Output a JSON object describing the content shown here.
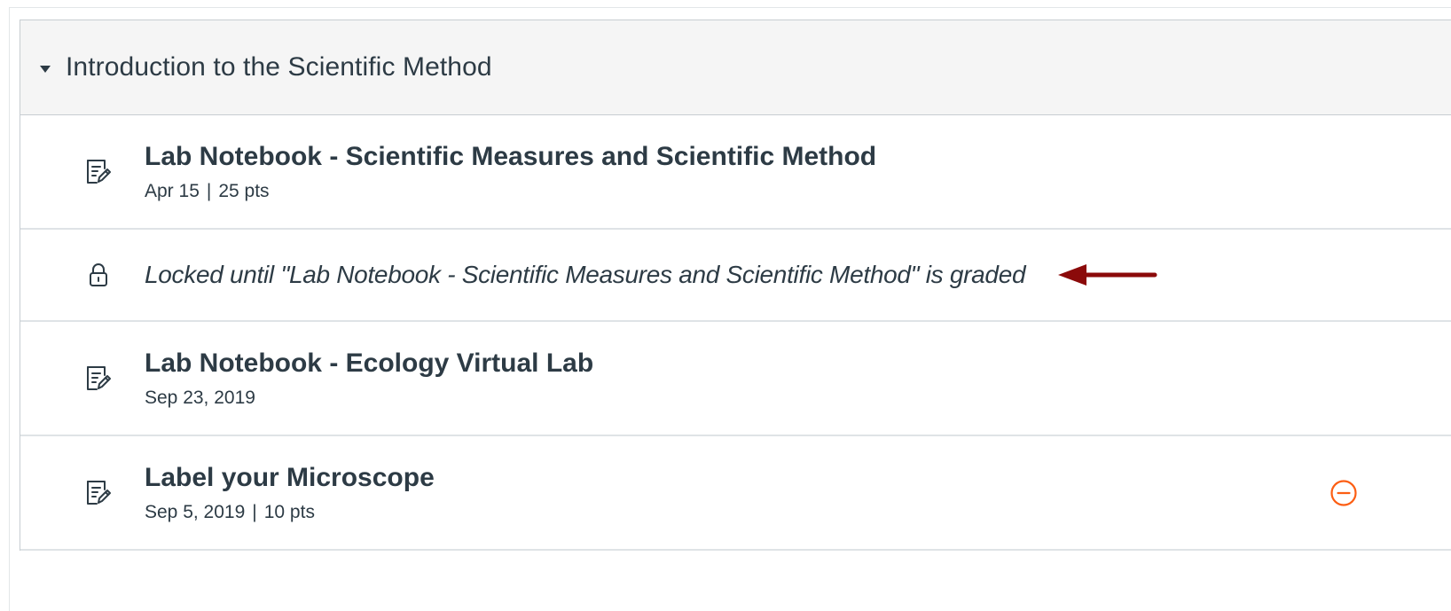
{
  "module": {
    "title": "Introduction to the Scientific Method",
    "collapse_icon": "caret-down-icon"
  },
  "items": [
    {
      "icon": "assignment-icon",
      "title": "Lab Notebook - Scientific Measures and Scientific Method",
      "date": "Apr 15",
      "separator": "|",
      "points": "25 pts"
    },
    {
      "icon": "lock-icon",
      "locked_text": "Locked until \"Lab Notebook - Scientific Measures and Scientific Method\" is graded",
      "callout": "arrow-left-icon",
      "callout_color": "#8b0a0a"
    },
    {
      "icon": "assignment-icon",
      "title": "Lab Notebook - Ecology Virtual Lab",
      "date": "Sep 23, 2019"
    },
    {
      "icon": "assignment-icon",
      "title": "Label your Microscope",
      "date": "Sep 5, 2019",
      "separator": "|",
      "points": "10 pts",
      "status_icon": "minus-circle-icon",
      "status_color": "#fc5e13"
    }
  ]
}
